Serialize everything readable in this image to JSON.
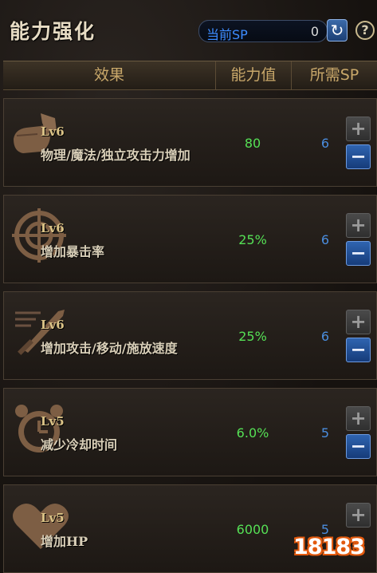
{
  "window": {
    "title": "能力强化",
    "sp_label": "当前SP",
    "sp_value": "0",
    "help_label": "?"
  },
  "table": {
    "columns": [
      "效果",
      "能力值",
      "所需SP"
    ],
    "rows": [
      {
        "level": "Lv6",
        "name": "物理/魔法/独立攻击力增加",
        "value": "80",
        "sp": "6",
        "icon": "fist-icon"
      },
      {
        "level": "Lv6",
        "name": "增加暴击率",
        "value": "25%",
        "sp": "6",
        "icon": "crosshair-icon"
      },
      {
        "level": "Lv6",
        "name": "增加攻击/移动/施放速度",
        "value": "25%",
        "sp": "6",
        "icon": "sword-icon"
      },
      {
        "level": "Lv5",
        "name": "减少冷却时间",
        "value": "6.0%",
        "sp": "5",
        "icon": "alarm-clock-icon"
      },
      {
        "level": "Lv5",
        "name": "增加HP",
        "value": "6000",
        "sp": "5",
        "icon": "heart-icon"
      }
    ],
    "plus_label": "+",
    "minus_label": "−"
  },
  "watermark": {
    "text": "18183"
  },
  "colors": {
    "value_green": "#55e055",
    "sp_blue": "#4a8dde",
    "header_gold": "#c9a86a"
  }
}
